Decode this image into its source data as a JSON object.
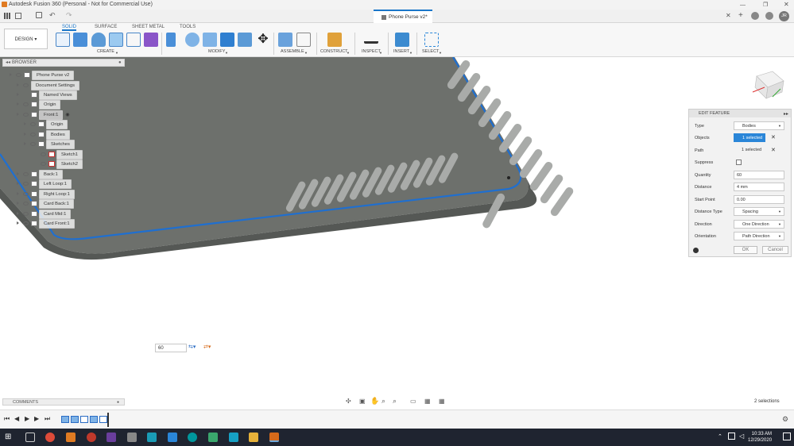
{
  "titlebar": {
    "app_title": "Autodesk Fusion 360 (Personal - Not for Commercial Use)"
  },
  "tabbar": {
    "doc_title": "Phone Purse v2*"
  },
  "ribbon": {
    "workspace": "DESIGN",
    "tabs": [
      "SOLID",
      "SURFACE",
      "SHEET METAL",
      "TOOLS"
    ],
    "groups": [
      "CREATE",
      "MODIFY",
      "ASSEMBLE",
      "CONSTRUCT",
      "INSPECT",
      "INSERT",
      "SELECT"
    ]
  },
  "browser": {
    "title": "BROWSER",
    "items": [
      {
        "label": "Phone Purse v2"
      },
      {
        "label": "Document Settings"
      },
      {
        "label": "Named Views"
      },
      {
        "label": "Origin"
      },
      {
        "label": "Front:1"
      },
      {
        "label": "Origin"
      },
      {
        "label": "Bodies"
      },
      {
        "label": "Sketches"
      },
      {
        "label": "Sketch1"
      },
      {
        "label": "Sketch2"
      },
      {
        "label": "Back:1"
      },
      {
        "label": "Left Loop:1"
      },
      {
        "label": "Right Loop:1"
      },
      {
        "label": "Card Back:1"
      },
      {
        "label": "Card Mid:1"
      },
      {
        "label": "Card Front:1"
      }
    ]
  },
  "edit_feature": {
    "title": "EDIT FEATURE",
    "rows": [
      {
        "label": "Type",
        "value": "Bodies"
      },
      {
        "label": "Objects",
        "value": "1 selected"
      },
      {
        "label": "Path",
        "value": "1 selected"
      },
      {
        "label": "Suppress",
        "value": ""
      },
      {
        "label": "Quantity",
        "value": "60"
      },
      {
        "label": "Distance",
        "value": "4 mm"
      },
      {
        "label": "Start Point",
        "value": "0.00"
      },
      {
        "label": "Distance Type",
        "value": "Spacing"
      },
      {
        "label": "Direction",
        "value": "One Direction"
      },
      {
        "label": "Orientation",
        "value": "Path Direction"
      }
    ],
    "ok_label": "OK",
    "cancel_label": "Cancel"
  },
  "viewport": {
    "quantity_input": "60"
  },
  "comments": {
    "label": "COMMENTS"
  },
  "status": {
    "selections": "2 selections"
  },
  "taskbar": {
    "time": "10:33 AM",
    "date": "12/29/2020"
  },
  "user": {
    "initials": "JR"
  },
  "colors": {
    "accent": "#1a76c9",
    "body": "#6d706c",
    "path": "#1f6fd0",
    "taskbar": "#1f2430"
  }
}
